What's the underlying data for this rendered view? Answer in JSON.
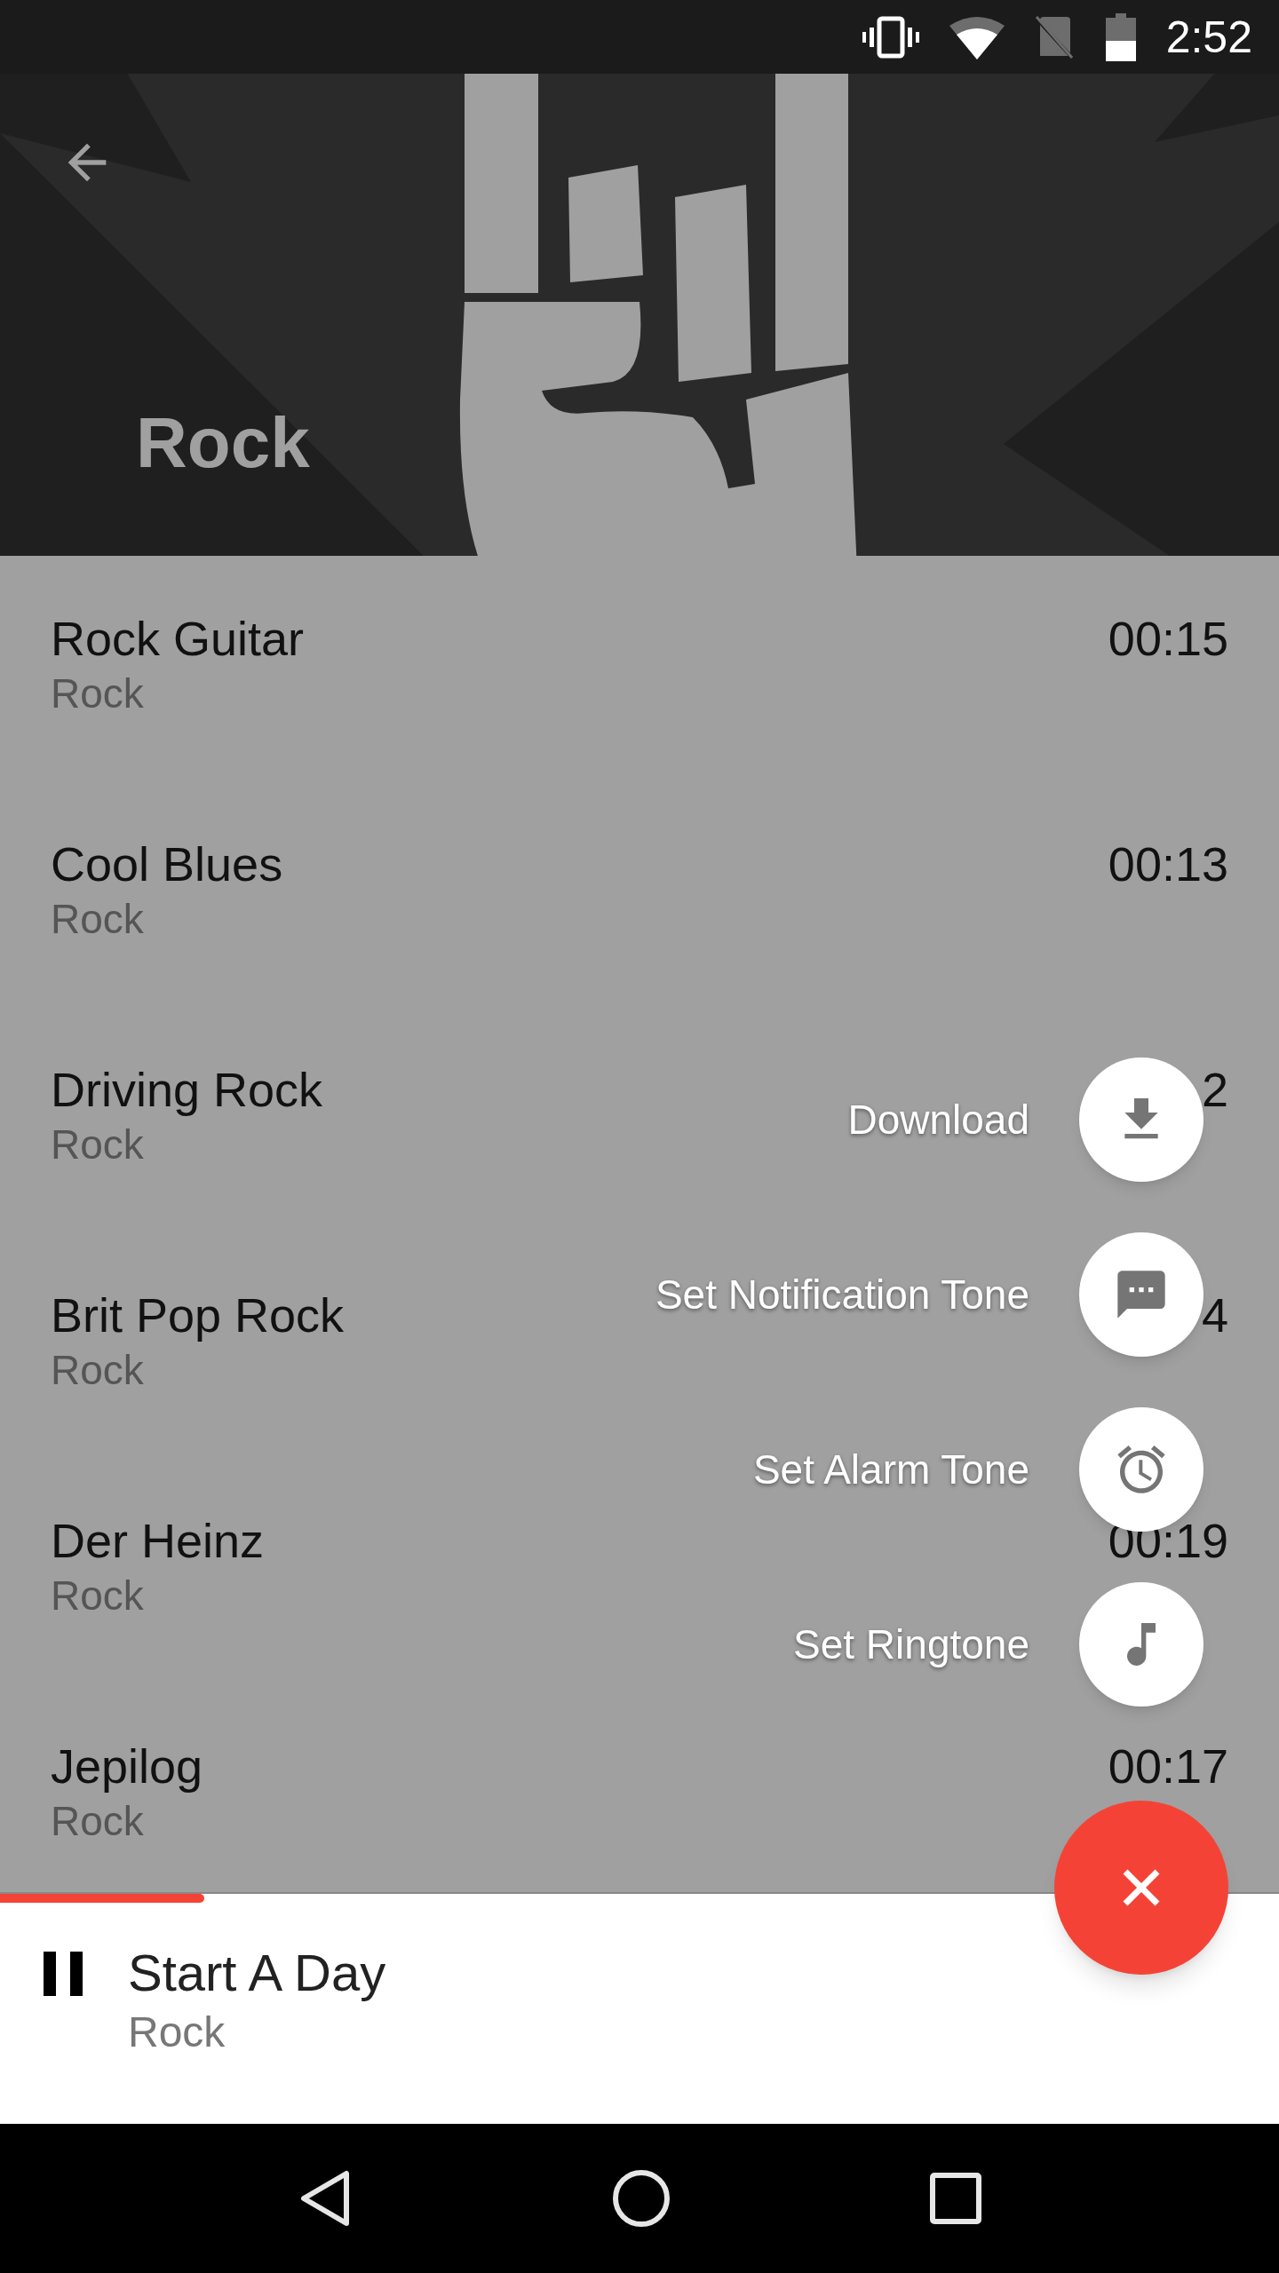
{
  "status_bar": {
    "time": "2:52"
  },
  "header": {
    "title": "Rock"
  },
  "tracks": [
    {
      "title": "Rock Guitar",
      "genre": "Rock",
      "duration": "00:15"
    },
    {
      "title": "Cool Blues",
      "genre": "Rock",
      "duration": "00:13"
    },
    {
      "title": "Driving Rock",
      "genre": "Rock",
      "duration": "2"
    },
    {
      "title": "Brit Pop Rock",
      "genre": "Rock",
      "duration": "4"
    },
    {
      "title": "Der Heinz",
      "genre": "Rock",
      "duration": "00:19"
    },
    {
      "title": "Jepilog",
      "genre": "Rock",
      "duration": "00:17"
    }
  ],
  "fab_menu": {
    "open": true,
    "actions": [
      {
        "label": "Download",
        "kind": "download"
      },
      {
        "label": "Set Notification Tone",
        "kind": "notification"
      },
      {
        "label": "Set Alarm Tone",
        "kind": "alarm"
      },
      {
        "label": "Set Ringtone",
        "kind": "ringtone"
      }
    ]
  },
  "player": {
    "title": "Start A Day",
    "genre": "Rock",
    "playing": true,
    "level": 0.16
  }
}
